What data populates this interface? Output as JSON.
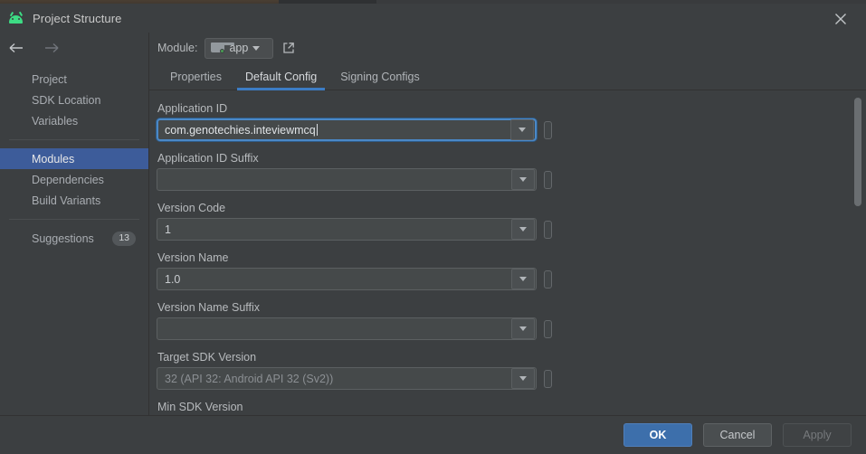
{
  "window": {
    "title": "Project Structure",
    "app_icon": "android-icon",
    "close_icon": "close-icon"
  },
  "nav": {
    "back_icon": "arrow-left-icon",
    "forward_icon": "arrow-right-icon"
  },
  "sidebar": {
    "items": [
      {
        "label": "Project",
        "selected": false
      },
      {
        "label": "SDK Location",
        "selected": false
      },
      {
        "label": "Variables",
        "selected": false
      },
      {
        "label": "Modules",
        "selected": true
      },
      {
        "label": "Dependencies",
        "selected": false
      },
      {
        "label": "Build Variants",
        "selected": false
      }
    ],
    "suggestions": {
      "label": "Suggestions",
      "badge": "13"
    }
  },
  "module_bar": {
    "label": "Module:",
    "selected_module": "app",
    "module_icon": "folder-icon",
    "open_external_icon": "external-link-icon",
    "dropdown_icon": "chevron-down-icon"
  },
  "tabs": [
    {
      "label": "Properties",
      "active": false
    },
    {
      "label": "Default Config",
      "active": true
    },
    {
      "label": "Signing Configs",
      "active": false
    }
  ],
  "form": {
    "fields": [
      {
        "label": "Application ID",
        "value": "com.genotechies.inteviewmcq",
        "placeholder": "",
        "focused": true,
        "disabled": false,
        "suffix": ""
      },
      {
        "label": "Application ID Suffix",
        "value": "",
        "placeholder": "",
        "focused": false,
        "disabled": false,
        "suffix": ""
      },
      {
        "label": "Version Code",
        "value": "1",
        "placeholder": "",
        "focused": false,
        "disabled": false,
        "suffix": ""
      },
      {
        "label": "Version Name",
        "value": "1.0",
        "placeholder": "",
        "focused": false,
        "disabled": false,
        "suffix": ""
      },
      {
        "label": "Version Name Suffix",
        "value": "",
        "placeholder": "",
        "focused": false,
        "disabled": false,
        "suffix": ""
      },
      {
        "label": "Target SDK Version",
        "value": "32",
        "placeholder": "",
        "focused": false,
        "disabled": true,
        "suffix": "(API 32: Android API 32 (Sv2))"
      },
      {
        "label": "Min SDK Version",
        "value": "",
        "placeholder": "",
        "focused": false,
        "disabled": true,
        "suffix": ""
      }
    ]
  },
  "footer": {
    "ok_label": "OK",
    "cancel_label": "Cancel",
    "apply_label": "Apply"
  },
  "colors": {
    "accent_blue": "#3c7cc4",
    "selection_blue": "#3d5c9a",
    "primary_button": "#3d6fab",
    "android_green": "#3ddc84",
    "window_bg": "#3c3f41",
    "field_bg": "#45494a"
  }
}
